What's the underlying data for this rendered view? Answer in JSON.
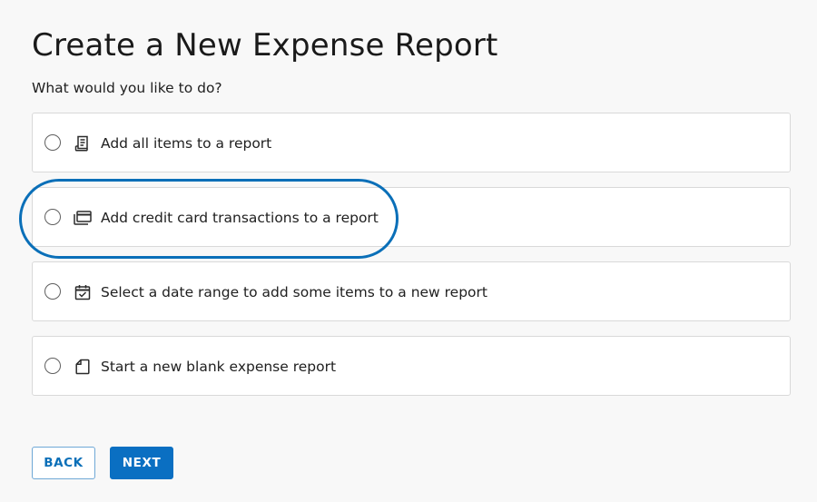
{
  "page": {
    "title": "Create a New Expense Report",
    "subtitle": "What would you like to do?"
  },
  "options": [
    {
      "label": "Add all items to a report",
      "icon": "receipt-icon",
      "selected": false
    },
    {
      "label": "Add credit card transactions to a report",
      "icon": "credit-cards-icon",
      "selected": false
    },
    {
      "label": "Select a date range to add some items to a new report",
      "icon": "calendar-check-icon",
      "selected": false
    },
    {
      "label": "Start a new blank expense report",
      "icon": "blank-document-icon",
      "selected": false
    }
  ],
  "actions": {
    "back_label": "BACK",
    "next_label": "NEXT"
  },
  "colors": {
    "accent": "#0a6fc2",
    "highlight": "#0a6fb8",
    "background": "#f8f8f8",
    "card_border": "#d9d9d9"
  }
}
